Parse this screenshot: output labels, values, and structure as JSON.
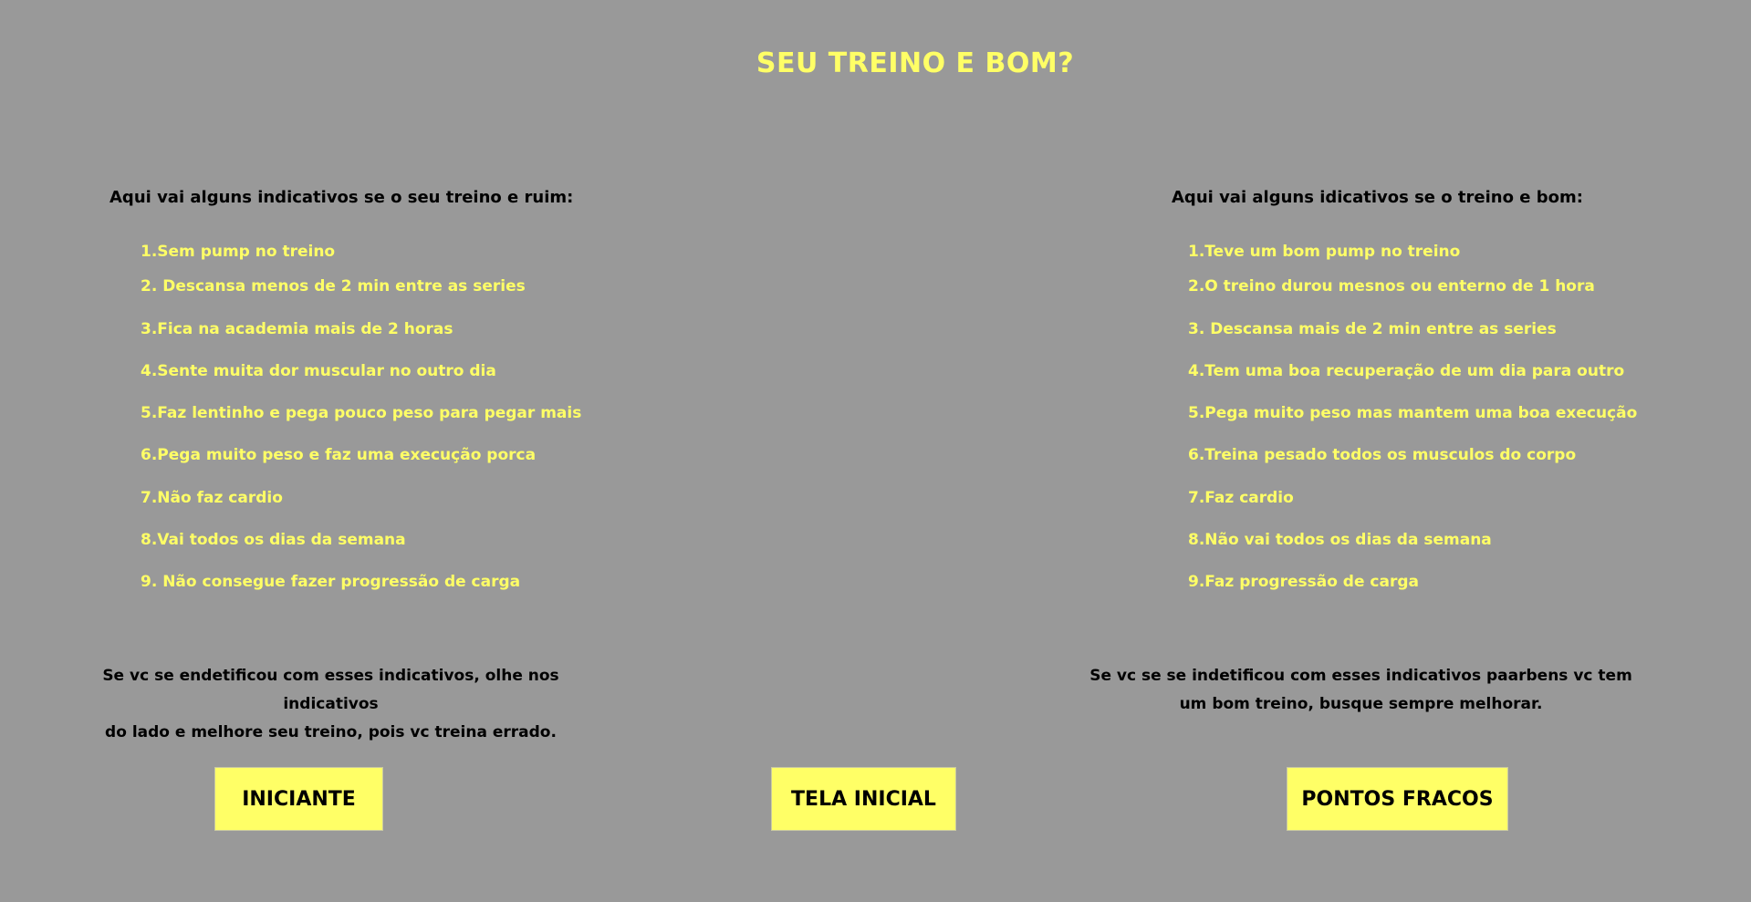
{
  "title": "SEU TREINO E BOM?",
  "left": {
    "heading": "Aqui vai alguns indicativos se o seu treino e ruim:",
    "items": [
      "1.Sem pump no treino",
      "2. Descansa menos de 2 min entre as series",
      "3.Fica na academia mais de 2 horas",
      "4.Sente muita dor muscular no outro dia",
      "5.Faz lentinho e pega pouco peso para pegar mais",
      "6.Pega muito peso e faz uma execução porca",
      "7.Não faz cardio",
      "8.Vai todos os dias da semana",
      "9. Não consegue fazer progressão de carga"
    ],
    "conclusion_line1": "Se vc se endetificou com esses indicativos, olhe nos indicativos",
    "conclusion_line2": "do lado e melhore seu treino, pois vc treina errado."
  },
  "right": {
    "heading": "Aqui vai alguns idicativos se o treino e bom:",
    "items": [
      "1.Teve um bom pump no treino",
      "2.O treino durou mesnos ou enterno de 1 hora",
      "3. Descansa mais de 2 min entre as series",
      "4.Tem uma boa recuperação de um dia para outro",
      "5.Pega muito peso mas mantem uma boa execução",
      "6.Treina pesado todos os musculos do corpo",
      "7.Faz cardio",
      "8.Não vai todos os dias da semana",
      "9.Faz progressão de carga"
    ],
    "conclusion_line1": "Se vc se se indetificou com esses indicativos paarbens vc tem",
    "conclusion_line2": "um bom treino, busque sempre melhorar."
  },
  "buttons": {
    "iniciante": "INICIANTE",
    "tela_inicial": "TELA INICIAL",
    "pontos_fracos": "PONTOS FRACOS"
  },
  "colors": {
    "background": "#999999",
    "accent_text": "#ffff66",
    "button_bg": "#ffff66",
    "dark_text": "#000000"
  }
}
